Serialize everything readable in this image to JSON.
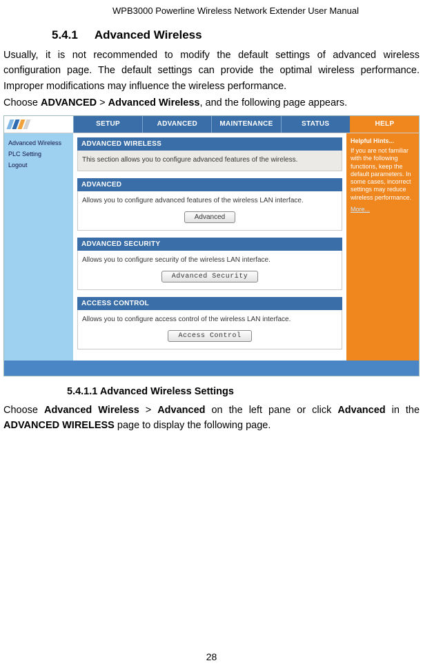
{
  "header": {
    "model": "WPB3000",
    "rest": " Powerline Wireless Network Extender User Manual"
  },
  "sec1": {
    "num": "5.4.1",
    "title": "Advanced Wireless"
  },
  "para1": "Usually, it is not recommended to modify the default settings of advanced wireless configuration page. The default settings can provide the optimal wireless performance. Improper modifications may influence the wireless performance.",
  "para2_pre": "Choose ",
  "para2_b1": "ADVANCED",
  "para2_mid": " > ",
  "para2_b2": "Advanced Wireless",
  "para2_post": ", and the following page appears.",
  "router": {
    "tabs": {
      "setup": "SETUP",
      "advanced": "ADVANCED",
      "maintenance": "MAINTENANCE",
      "status": "STATUS",
      "help": "HELP"
    },
    "sidebar": {
      "adv_wireless": "Advanced Wireless",
      "plc": "PLC Setting",
      "logout": "Logout"
    },
    "panels": {
      "aw_head": "ADVANCED WIRELESS",
      "aw_body": "This section allows you to configure advanced features of the wireless.",
      "adv_head": "ADVANCED",
      "adv_body": "Allows you to configure advanced features of the wireless LAN interface.",
      "adv_btn": "Advanced",
      "sec_head": "ADVANCED SECURITY",
      "sec_body": "Allows you to configure security of the wireless LAN interface.",
      "sec_btn": "Advanced Security",
      "ac_head": "ACCESS CONTROL",
      "ac_body": "Allows you to configure access control of the wireless LAN interface.",
      "ac_btn": "Access Control"
    },
    "help": {
      "head": "Helpful Hints...",
      "body": "If you are not familiar with the following functions, keep the default parameters. In some cases, incorrect settings may reduce wireless performance.",
      "more": "More..."
    }
  },
  "sec2": {
    "num_title": "5.4.1.1 Advanced Wireless Settings"
  },
  "para3_pre": "Choose ",
  "para3_b1": "Advanced Wireless",
  "para3_mid1": " > ",
  "para3_b2": "Advanced",
  "para3_mid2": " on the left pane or click ",
  "para3_b3": "Advanced",
  "para3_mid3": " in the ",
  "para3_b4": "ADVANCED WIRELESS",
  "para3_post": " page to display the following page.",
  "page_number": "28"
}
